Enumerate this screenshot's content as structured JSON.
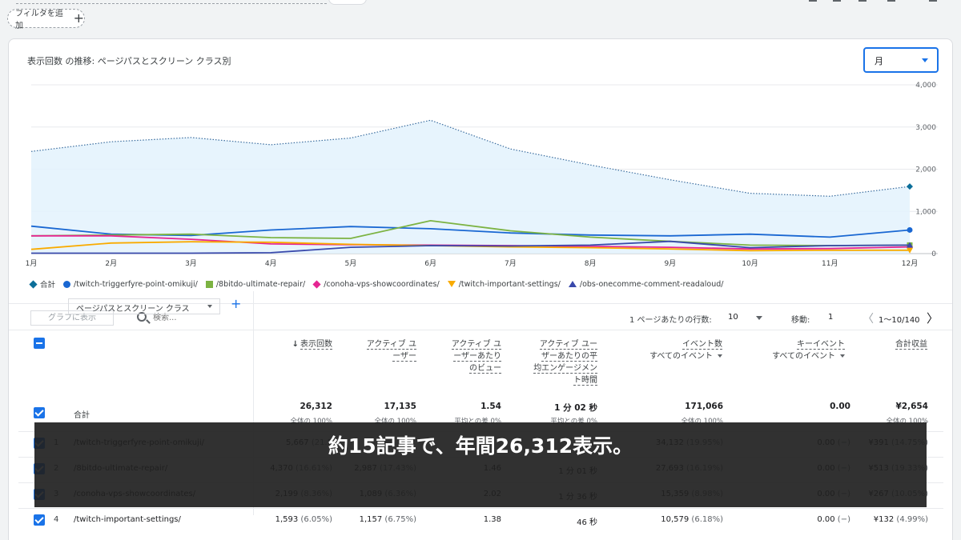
{
  "filter": {
    "add_label": "フィルタを追加",
    "plus": "+"
  },
  "chart": {
    "title": "表示回数 の推移: ページパスとスクリーン クラス別",
    "period": "月"
  },
  "chart_data": {
    "type": "line",
    "x": [
      "1月",
      "2月",
      "3月",
      "4月",
      "5月",
      "6月",
      "7月",
      "8月",
      "9月",
      "10月",
      "11月",
      "12月"
    ],
    "ylim": [
      0,
      4000
    ],
    "yticks": [
      "4,000",
      "3,000",
      "2,000",
      "1,000",
      "0"
    ],
    "ytick_values": [
      4000,
      3000,
      2000,
      1000,
      0
    ],
    "grid": true,
    "legend_position": "bottom",
    "series": [
      {
        "name": "合計",
        "color": "#1a73e8",
        "marker": "diamond",
        "style": "dotted-area",
        "values": [
          2420,
          2650,
          2750,
          2580,
          2740,
          3160,
          2480,
          2100,
          1750,
          1430,
          1360,
          1590
        ]
      },
      {
        "name": "/twitch-triggerfyre-point-omikuji/",
        "color": "#1967d2",
        "marker": "circle",
        "values": [
          650,
          460,
          430,
          560,
          640,
          590,
          490,
          440,
          420,
          460,
          390,
          560
        ]
      },
      {
        "name": "/8bitdo-ultimate-repair/",
        "color": "#7cb342",
        "marker": "square",
        "values": [
          420,
          440,
          460,
          380,
          360,
          780,
          540,
          390,
          290,
          200,
          190,
          200
        ]
      },
      {
        "name": "/conoha-vps-showcoordinates/",
        "color": "#e52592",
        "marker": "diamond",
        "values": [
          420,
          420,
          340,
          230,
          210,
          200,
          190,
          170,
          150,
          110,
          120,
          160
        ]
      },
      {
        "name": "/twitch-important-settings/",
        "color": "#f9ab00",
        "marker": "triangle-down",
        "values": [
          100,
          250,
          280,
          270,
          220,
          190,
          160,
          140,
          110,
          70,
          80,
          80
        ]
      },
      {
        "name": "/obs-onecomme-comment-readaloud/",
        "color": "#3949ab",
        "marker": "triangle-up",
        "values": [
          10,
          10,
          10,
          20,
          150,
          190,
          180,
          200,
          290,
          140,
          190,
          200
        ]
      }
    ]
  },
  "toolbar": {
    "graph_btn": "グラフに表示",
    "search_placeholder": "検索...",
    "rows_label": "1 ページあたりの行数:",
    "rows_value": "10",
    "goto_label": "移動:",
    "goto_value": "1",
    "range": "1〜10/140",
    "prev": "〈",
    "next": "〉"
  },
  "table": {
    "dimension": "ページパスとスクリーン クラス",
    "add_dimension": "+",
    "headers": {
      "views": "表示回数",
      "sort": "↓",
      "active_1": "アクティブ ユ",
      "active_2": "ーザー",
      "vpu_1": "アクティブ ユ",
      "vpu_2": "ーザーあたり",
      "vpu_3": "のビュー",
      "eng_1": "アクティブ ユー",
      "eng_2": "ザーあたりの平",
      "eng_3": "均エンゲージメン",
      "eng_4": "ト時間",
      "events": "イベント数",
      "events_sub": "すべてのイベント",
      "key": "キーイベント",
      "key_sub": "すべてのイベント",
      "revenue": "合計収益"
    },
    "total": {
      "label": "合計",
      "views": "26,312",
      "views_sub": "全体の 100%",
      "active": "17,135",
      "active_sub": "全体の 100%",
      "vpu": "1.54",
      "vpu_sub": "平均との差 0%",
      "eng": "1 分 02 秒",
      "eng_sub": "平均との差 0%",
      "events": "171,066",
      "events_sub": "全体の 100%",
      "key": "0.00",
      "revenue": "¥2,654",
      "revenue_sub": "全体の 100%"
    },
    "rows": [
      {
        "num": "1",
        "path": "/twitch-triggerfyre-point-omikuji/",
        "views": "5,667",
        "views_pct": "(21.5",
        "active": "",
        "active_pct": "",
        "vpu": "",
        "eng": "",
        "events": "34,132",
        "events_pct": "(19.95%)",
        "key": "0.00",
        "key_pct": "(−)",
        "revenue": "¥391",
        "revenue_pct": "(14.75%)"
      },
      {
        "num": "2",
        "path": "/8bitdo-ultimate-repair/",
        "views": "4,370",
        "views_pct": "(16.61%)",
        "active": "2,987",
        "active_pct": "(17.43%)",
        "vpu": "1.46",
        "eng": "1 分 01 秒",
        "events": "27,693",
        "events_pct": "(16.19%)",
        "key": "0.00",
        "key_pct": "(−)",
        "revenue": "¥513",
        "revenue_pct": "(19.33%)"
      },
      {
        "num": "3",
        "path": "/conoha-vps-showcoordinates/",
        "views": "2,199",
        "views_pct": "(8.36%)",
        "active": "1,089",
        "active_pct": "(6.36%)",
        "vpu": "2.02",
        "eng": "1 分 36 秒",
        "events": "15,359",
        "events_pct": "(8.98%)",
        "key": "0.00",
        "key_pct": "(−)",
        "revenue": "¥267",
        "revenue_pct": "(10.05%)"
      },
      {
        "num": "4",
        "path": "/twitch-important-settings/",
        "views": "1,593",
        "views_pct": "(6.05%)",
        "active": "1,157",
        "active_pct": "(6.75%)",
        "vpu": "1.38",
        "eng": "46 秒",
        "events": "10,579",
        "events_pct": "(6.18%)",
        "key": "0.00",
        "key_pct": "(−)",
        "revenue": "¥132",
        "revenue_pct": "(4.99%)"
      }
    ]
  },
  "caption": "約15記事で、年間26,312表示。"
}
